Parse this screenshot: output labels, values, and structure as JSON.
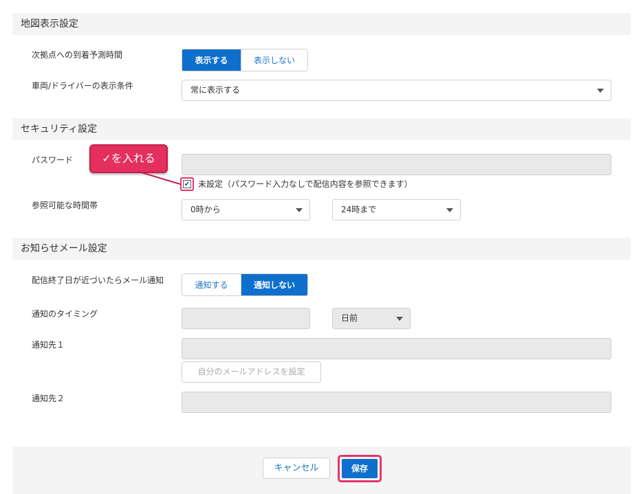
{
  "map_section": {
    "title": "地図表示設定",
    "arrival_label": "次拠点への到着予測時間",
    "arrival_options": [
      "表示する",
      "表示しない"
    ],
    "arrival_selected": "表示する",
    "vehicle_label": "車両/ドライバーの表示条件",
    "vehicle_value": "常に表示する"
  },
  "security_section": {
    "title": "セキュリティ設定",
    "password_label": "パスワード",
    "callout": "✓を入れる",
    "unset_checked": true,
    "unset_label": "未設定（パスワード入力なしで配信内容を参照できます）",
    "time_label": "参照可能な時間帯",
    "time_from": "0時から",
    "time_to": "24時まで"
  },
  "mail_section": {
    "title": "お知らせメール設定",
    "notify_label": "配信終了日が近づいたらメール通知",
    "notify_options": [
      "通知する",
      "通知しない"
    ],
    "notify_selected": "通知しない",
    "timing_label": "通知のタイミング",
    "timing_unit": "日前",
    "dest1_label": "通知先１",
    "set_own_button": "自分のメールアドレスを設定",
    "dest2_label": "通知先２"
  },
  "footer": {
    "cancel": "キャンセル",
    "save": "保存"
  },
  "colors": {
    "primary": "#0f6fcc",
    "highlight": "#e8336d",
    "section_bg": "#f4f4f4",
    "disabled_bg": "#e9e9e9"
  }
}
